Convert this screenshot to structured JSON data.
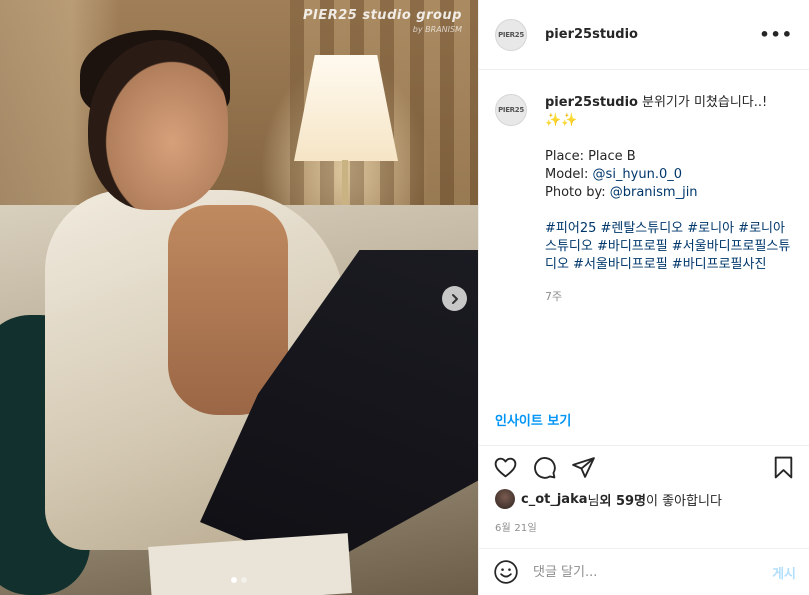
{
  "post": {
    "username": "pier25studio",
    "avatar_text": "PIER25",
    "more_label": "•••",
    "caption": {
      "username": "pier25studio",
      "text": "분위기가 미쳤습니다..!",
      "emoji": "✨✨",
      "place": "Place: Place B",
      "model_prefix": "Model: ",
      "model_handle": "@si_hyun.0_0",
      "photo_prefix": "Photo by: ",
      "photo_handle": "@branism_jin",
      "hashtags": "#피어25 #렌탈스튜디오 #로니아 #로니아스튜디오 #바디프로필 #서울바디프로필스튜디오 #서울바디프로필 #바디프로필사진",
      "time": "7주"
    },
    "insights_label": "인사이트 보기",
    "likes": {
      "user": "c_ot_jaka",
      "connector": "님 ",
      "others": "외 59명",
      "suffix": "이 좋아합니다"
    },
    "date": "6월 21일",
    "comment_placeholder": "댓글 달기...",
    "post_label": "게시"
  },
  "photo": {
    "watermark_main": "PIER25 studio group",
    "watermark_sub": "by BRANISM",
    "next_icon": "chevron-right-icon",
    "slides": 2,
    "active_slide": 1
  },
  "colors": {
    "link": "#00376b",
    "accent": "#0095f6",
    "post_disabled": "#b2dffc",
    "muted": "#8e8e8e"
  }
}
